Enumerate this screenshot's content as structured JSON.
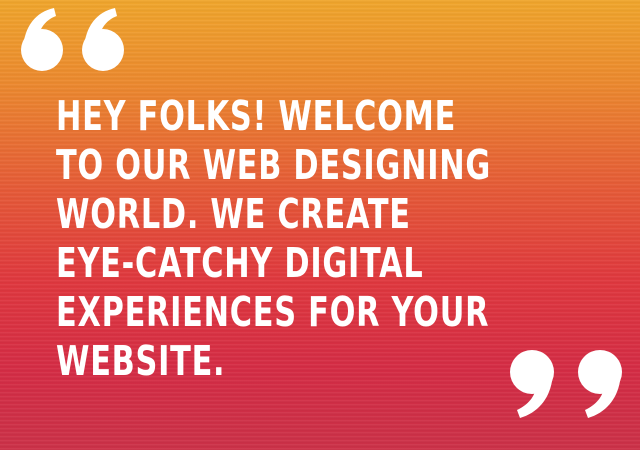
{
  "quote": {
    "lines": [
      "HEY FOLKS! WELCOME",
      "TO OUR WEB DESIGNING",
      "WORLD. WE CREATE",
      "EYE-CATCHY DIGITAL",
      "EXPERIENCES FOR YOUR",
      "WEBSITE."
    ]
  },
  "icons": {
    "open_quote": "open-quote-icon",
    "close_quote": "close-quote-icon"
  },
  "colors": {
    "text": "#ffffff",
    "gradient_top": "#f0a62c",
    "gradient_mid": "#e65a37",
    "gradient_bottom": "#cc3148"
  }
}
